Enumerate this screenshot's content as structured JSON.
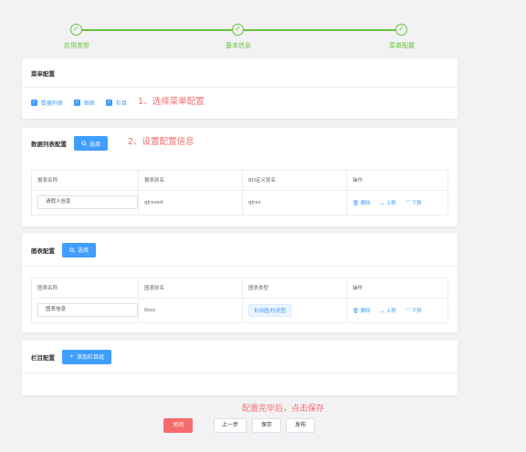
{
  "steps": [
    {
      "label": "应用类型"
    },
    {
      "label": "基本信息"
    },
    {
      "label": "菜单配置"
    }
  ],
  "menu_config": {
    "title": "菜单配置",
    "checkboxes": [
      {
        "label": "数据列表",
        "checked": true
      },
      {
        "label": "图表",
        "checked": true
      },
      {
        "label": "栏目",
        "checked": true
      }
    ],
    "annotation": "1、选择菜单配置"
  },
  "data_list_config": {
    "title": "数据列表配置",
    "select_label": "选择",
    "annotation": "2、设置配置信息",
    "columns": [
      "报表名称",
      "报表别名",
      "BO定义别名",
      "操作"
    ],
    "rows": [
      {
        "name": "请假人信息",
        "alias": "qjrxxed",
        "bo_alias": "qjrxx"
      }
    ]
  },
  "chart_config": {
    "title": "图表配置",
    "select_label": "选择",
    "columns": [
      "图表名称",
      "图表别名",
      "图表类型",
      "操作"
    ],
    "rows": [
      {
        "name": "图表信息",
        "alias": "tbxx",
        "type": "折线图/柱状图"
      }
    ]
  },
  "column_config": {
    "title": "栏目配置",
    "add_label": "添加栏目组"
  },
  "row_actions": {
    "delete": "删除",
    "up": "上移",
    "down": "下移"
  },
  "footer": {
    "hint": "配置完毕后，点击保存",
    "close": "关闭",
    "prev": "上一步",
    "save": "保存",
    "publish": "发布"
  },
  "colors": {
    "success": "#67c23a",
    "primary": "#409eff",
    "danger": "#f56c6c"
  }
}
